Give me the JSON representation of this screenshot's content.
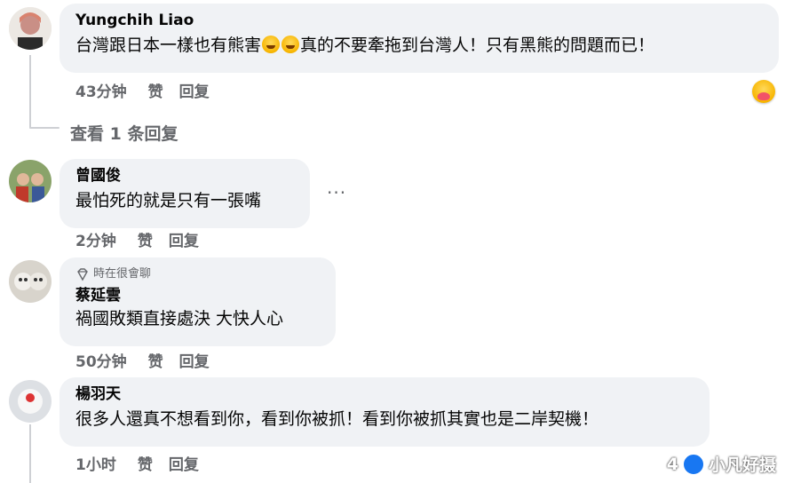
{
  "comments": [
    {
      "author": "Yungchih Liao",
      "text_before": "台灣跟日本一樣也有熊害",
      "text_after": "真的不要牽拖到台灣人！只有黑熊的問題而已！",
      "inline_emojis": [
        "rolling-on-floor-laughing",
        "rolling-on-floor-laughing"
      ],
      "time": "43分钟",
      "like": "赞",
      "reply": "回复",
      "reaction_icon": "hugging-face"
    },
    {
      "author": "曾國俊",
      "text": "最怕死的就是只有一張嘴",
      "time": "2分钟",
      "like": "赞",
      "reply": "回复",
      "more": "···"
    },
    {
      "badge": "時在很會聊",
      "badge_icon": "diamond-icon",
      "author": "蔡延雲",
      "text": "禍國敗類直接處決 大快人心",
      "time": "50分钟",
      "like": "赞",
      "reply": "回复"
    },
    {
      "author": "楊羽天",
      "text": "很多人還真不想看到你，看到你被抓！看到你被抓其實也是二岸契機！",
      "time": "1小时",
      "like": "赞",
      "reply": "回复"
    }
  ],
  "view_replies": "查看 1 条回复",
  "watermark": {
    "count": "4",
    "text": "小凡好摄"
  }
}
